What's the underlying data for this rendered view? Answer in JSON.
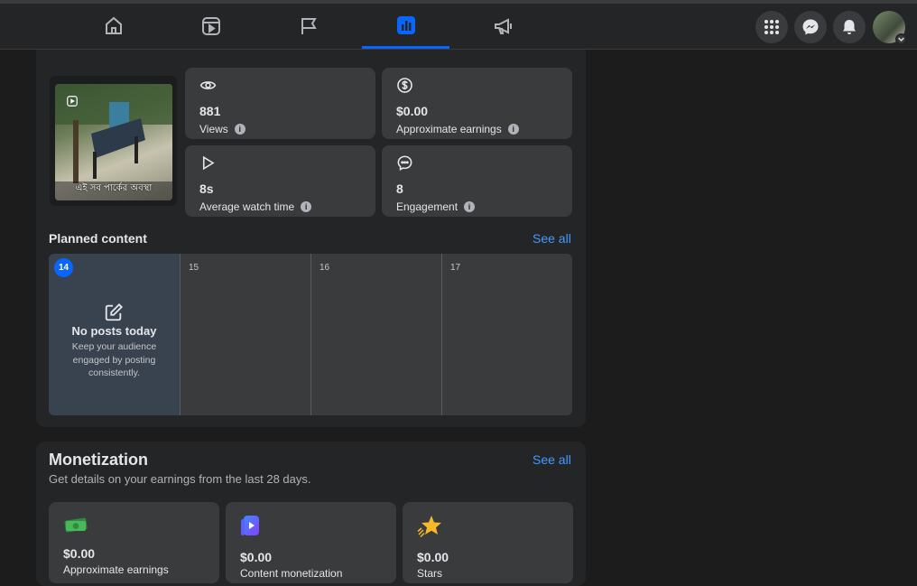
{
  "nav": {
    "tabs": [
      {
        "name": "home-icon"
      },
      {
        "name": "video-icon"
      },
      {
        "name": "flag-icon"
      },
      {
        "name": "insights-icon",
        "active": true
      },
      {
        "name": "megaphone-icon"
      }
    ],
    "right": [
      "menu-grid-icon",
      "messenger-icon",
      "bell-icon",
      "avatar"
    ]
  },
  "post": {
    "thumbnail_caption": "এই সব পার্কের অবস্থা",
    "stats": [
      {
        "icon": "eye-icon",
        "value": "881",
        "label": "Views"
      },
      {
        "icon": "dollar-icon",
        "value": "$0.00",
        "label": "Approximate earnings"
      },
      {
        "icon": "play-icon",
        "value": "8s",
        "label": "Average watch time"
      },
      {
        "icon": "comment-icon",
        "value": "8",
        "label": "Engagement"
      }
    ]
  },
  "planned": {
    "title": "Planned content",
    "see_all": "See all",
    "today_day": "14",
    "today_title": "No posts today",
    "today_text": "Keep your audience engaged by posting consistently.",
    "days": [
      "15",
      "16",
      "17"
    ]
  },
  "monetization": {
    "title": "Monetization",
    "subtitle": "Get details on your earnings from the last 28 days.",
    "see_all": "See all",
    "items": [
      {
        "icon": "money-icon",
        "value": "$0.00",
        "label": "Approximate earnings"
      },
      {
        "icon": "content-monetization-icon",
        "value": "$0.00",
        "label": "Content monetization"
      },
      {
        "icon": "star-icon",
        "value": "$0.00",
        "label": "Stars"
      }
    ]
  },
  "colors": {
    "accent": "#0866ff",
    "link": "#4599ff",
    "card": "#242526",
    "tile": "#3a3b3c"
  }
}
